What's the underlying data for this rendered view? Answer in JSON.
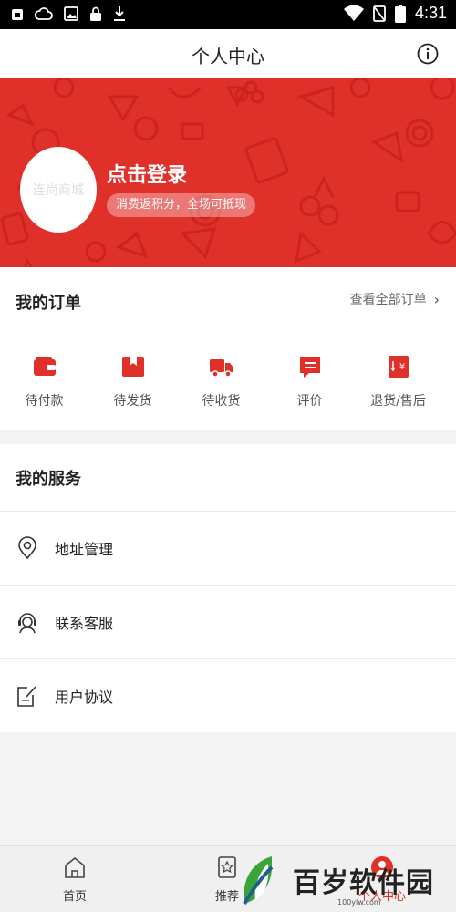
{
  "status_bar": {
    "time": "4:31",
    "left_icons": [
      "sim-icon",
      "cloud-icon",
      "image-icon",
      "lock-icon",
      "download-icon"
    ],
    "right_icons": [
      "wifi-icon",
      "no-sim-icon",
      "battery-icon"
    ]
  },
  "app_bar": {
    "title": "个人中心",
    "info_icon": "info-icon"
  },
  "profile": {
    "avatar_text": "连尚商城",
    "login_label": "点击登录",
    "points_text": "消费返积分，全场可抵现",
    "banner_color": "#e0302a"
  },
  "orders": {
    "heading": "我的订单",
    "view_all": "查看全部订单",
    "items": [
      {
        "label": "待付款",
        "icon": "wallet-icon"
      },
      {
        "label": "待发货",
        "icon": "box-icon"
      },
      {
        "label": "待收货",
        "icon": "truck-icon"
      },
      {
        "label": "评价",
        "icon": "comment-icon"
      },
      {
        "label": "退货/售后",
        "icon": "refund-icon"
      }
    ]
  },
  "services": {
    "heading": "我的服务",
    "items": [
      {
        "label": "地址管理",
        "icon": "location-pin-icon"
      },
      {
        "label": "联系客服",
        "icon": "customer-service-icon"
      },
      {
        "label": "用户协议",
        "icon": "agreement-icon"
      }
    ]
  },
  "bottom_nav": {
    "items": [
      {
        "label": "首页",
        "icon": "home-icon"
      },
      {
        "label": "推荐",
        "icon": "recommend-icon"
      },
      {
        "label": "个人中心",
        "icon": "user-icon",
        "active": true
      }
    ]
  },
  "watermark": {
    "text": "百岁软件园",
    "url": "100ylw.com"
  }
}
